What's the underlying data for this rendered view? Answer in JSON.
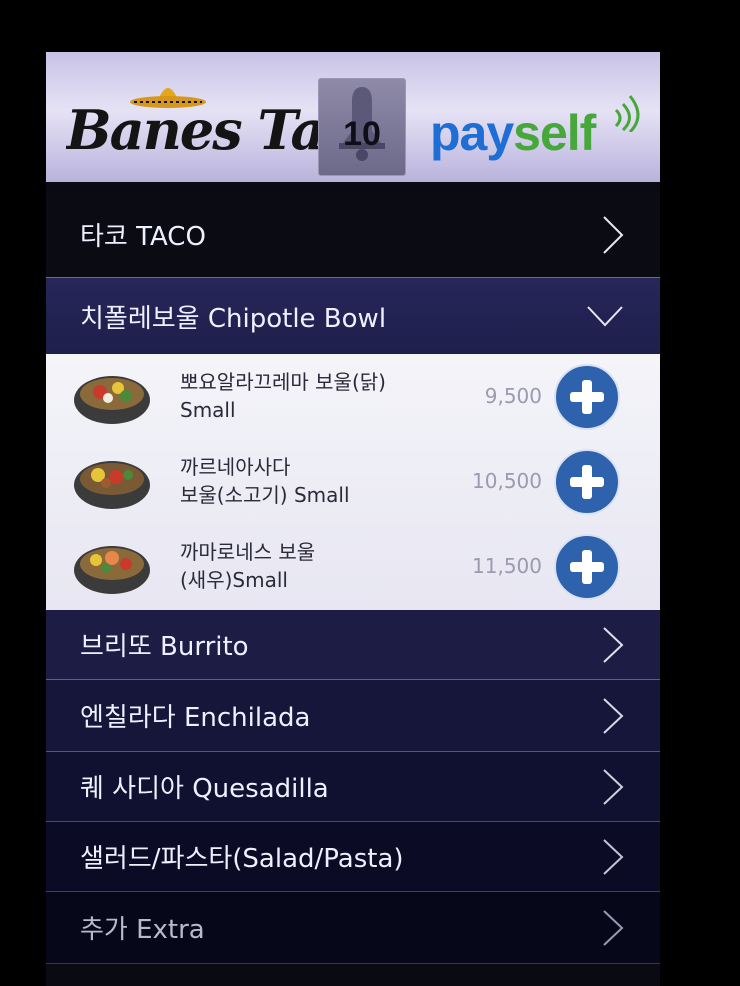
{
  "header": {
    "logo_text": "Banes Taco",
    "bell_number": "10",
    "payself_pay": "pay",
    "payself_self": "self"
  },
  "menu": {
    "taco": "타코 TACO",
    "chipotle_bowl": "치폴레보울 Chipotle Bowl",
    "burrito": "브리또 Burrito",
    "enchilada": "엔칠라다  Enchilada",
    "quesadilla": "퀘 사디아 Quesadilla",
    "salad_pasta": "샐러드/파스타(Salad/Pasta)",
    "extra": "추가 Extra"
  },
  "bowl_items": [
    {
      "name_line1": "뽀요알라끄레마 보울(닭)",
      "name_line2": "Small",
      "price": "9,500"
    },
    {
      "name_line1": "까르네아사다",
      "name_line2": "보울(소고기) Small",
      "price": "10,500"
    },
    {
      "name_line1": "까마로네스 보울",
      "name_line2": "(새우)Small",
      "price": "11,500"
    }
  ],
  "icons": {
    "collapsed": "chevron-right-icon",
    "expanded": "chevron-down-icon",
    "add": "plus-circle-icon",
    "bell": "bell-icon"
  },
  "colors": {
    "header_bg": "#d8d4ef",
    "category_bg": "#1c1c44",
    "add_button": "#2f62ad",
    "pay_blue": "#1f6ed4",
    "self_green": "#46a83a"
  }
}
